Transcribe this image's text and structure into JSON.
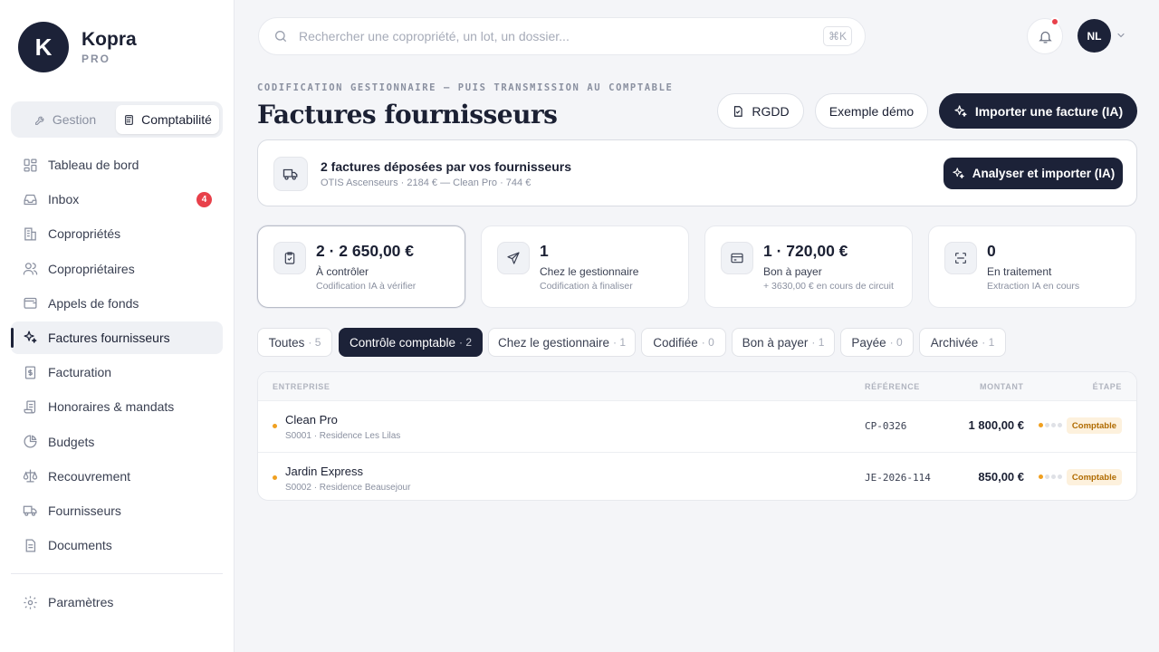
{
  "app": {
    "logo_letter": "K",
    "name": "Kopra",
    "edition": "PRO"
  },
  "mode_switch": {
    "gestion": "Gestion",
    "comptabilite": "Comptabilité"
  },
  "sidebar": {
    "items": [
      {
        "label": "Tableau de bord",
        "icon": "dashboard-icon"
      },
      {
        "label": "Inbox",
        "icon": "inbox-icon",
        "badge": "4"
      },
      {
        "label": "Copropriétés",
        "icon": "building-icon"
      },
      {
        "label": "Copropriétaires",
        "icon": "users-icon"
      },
      {
        "label": "Appels de fonds",
        "icon": "wallet-icon"
      },
      {
        "label": "Factures fournisseurs",
        "icon": "sparkles-icon",
        "active": true
      },
      {
        "label": "Facturation",
        "icon": "invoice-icon"
      },
      {
        "label": "Honoraires & mandats",
        "icon": "scroll-icon"
      },
      {
        "label": "Budgets",
        "icon": "pie-chart-icon"
      },
      {
        "label": "Recouvrement",
        "icon": "scale-icon"
      },
      {
        "label": "Fournisseurs",
        "icon": "truck-icon"
      },
      {
        "label": "Documents",
        "icon": "document-icon"
      }
    ],
    "settings": "Paramètres"
  },
  "search": {
    "placeholder": "Rechercher une copropriété, un lot, un dossier...",
    "shortcut": "⌘K"
  },
  "user": {
    "initials": "NL"
  },
  "header": {
    "eyebrow": "CODIFICATION GESTIONNAIRE — PUIS TRANSMISSION AU COMPTABLE",
    "title": "Factures fournisseurs",
    "btn_rgdd": "RGDD",
    "btn_demo": "Exemple démo",
    "btn_import": "Importer une facture (IA)"
  },
  "banner": {
    "title": "2 factures déposées par vos fournisseurs",
    "subtitle": "OTIS Ascenseurs · 2184 € — Clean Pro · 744 €",
    "button": "Analyser et importer (IA)"
  },
  "stats": [
    {
      "value": "2 · 2 650,00 €",
      "label": "À contrôler",
      "sub": "Codification IA à vérifier",
      "icon": "clipboard-check-icon"
    },
    {
      "value": "1",
      "label": "Chez le gestionnaire",
      "sub": "Codification à finaliser",
      "icon": "send-icon"
    },
    {
      "value": "1 · 720,00 €",
      "label": "Bon à payer",
      "sub": "+ 3630,00 € en cours de circuit",
      "icon": "credit-card-icon"
    },
    {
      "value": "0",
      "label": "En traitement",
      "sub": "Extraction IA en cours",
      "icon": "scan-icon"
    }
  ],
  "tabs": [
    {
      "label": "Toutes",
      "count": "· 5"
    },
    {
      "label": "Contrôle comptable",
      "count": "· 2",
      "active": true
    },
    {
      "label": "Chez le gestionnaire",
      "count": "· 1"
    },
    {
      "label": "Codifiée",
      "count": "· 0"
    },
    {
      "label": "Bon à payer",
      "count": "· 1"
    },
    {
      "label": "Payée",
      "count": "· 0"
    },
    {
      "label": "Archivée",
      "count": "· 1"
    }
  ],
  "table": {
    "headers": {
      "entreprise": "ENTREPRISE",
      "reference": "RÉFÉRENCE",
      "montant": "MONTANT",
      "etape": "ÉTAPE"
    },
    "rows": [
      {
        "name": "Clean Pro",
        "sub": "S0001 · Residence Les Lilas",
        "ref": "CP-0326",
        "amount": "1 800,00 €",
        "stage": "Comptable",
        "steps_done": 1,
        "steps_total": 4
      },
      {
        "name": "Jardin Express",
        "sub": "S0002 · Residence Beausejour",
        "ref": "JE-2026-114",
        "amount": "850,00 €",
        "stage": "Comptable",
        "steps_done": 1,
        "steps_total": 4
      }
    ]
  },
  "colors": {
    "primary": "#1c2238",
    "badge": "#e8404a",
    "status_dot": "#f0a020",
    "stage_pill_bg": "#fdf1dd",
    "stage_pill_text": "#b06b00"
  }
}
